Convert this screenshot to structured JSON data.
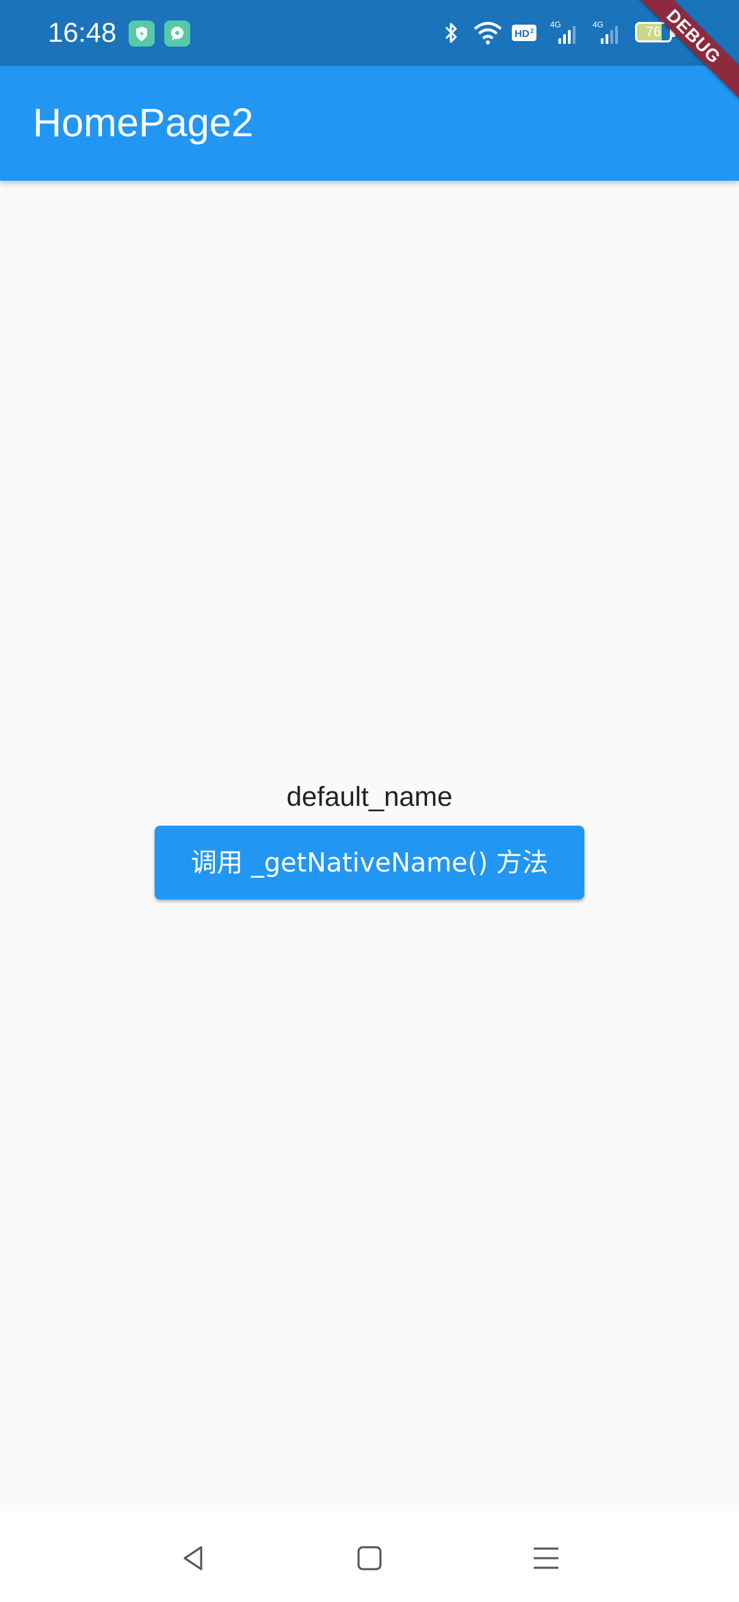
{
  "status_bar": {
    "time": "16:48",
    "battery_level": "76",
    "notification_icons": [
      "shield-app-icon",
      "chat-app-icon"
    ],
    "system_icons": [
      "bluetooth-icon",
      "wifi-icon",
      "hd-voice-icon",
      "signal-4g-icon",
      "signal-4g-icon",
      "battery-icon",
      "charging-icon"
    ],
    "color": "#1a73bb"
  },
  "app_bar": {
    "title": "HomePage2",
    "color": "#2196f3"
  },
  "debug_banner": {
    "label": "DEBUG"
  },
  "main": {
    "result_text": "default_name",
    "button_label": "调用 _getNativeName() 方法",
    "button_color": "#2196f3"
  },
  "nav_bar": {
    "buttons": [
      "back-icon",
      "home-icon",
      "menu-icon"
    ]
  }
}
